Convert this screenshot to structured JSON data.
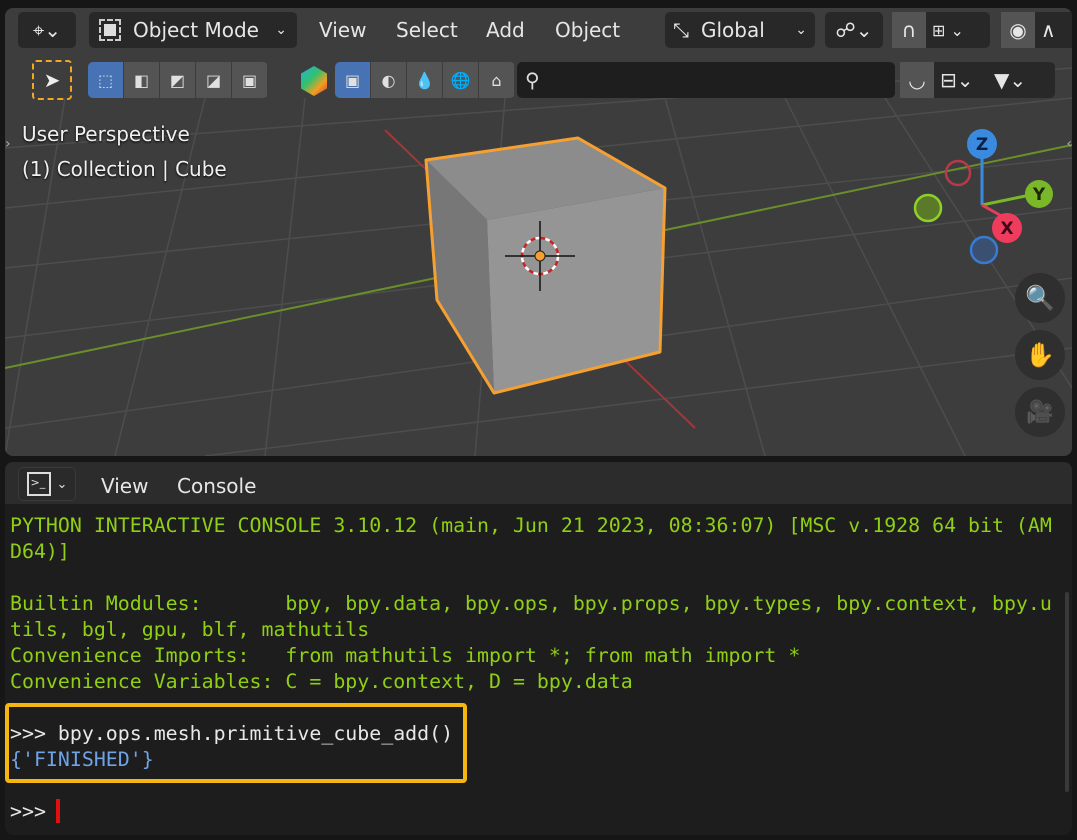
{
  "header": {
    "mode": "Object Mode",
    "menus": [
      "View",
      "Select",
      "Add",
      "Object"
    ],
    "orientation": "Global",
    "search_placeholder": ""
  },
  "viewport": {
    "perspective": "User Perspective",
    "collection": "(1) Collection | Cube",
    "gizmo": {
      "z": "Z",
      "y": "Y",
      "x": "X"
    }
  },
  "console_header": {
    "menus": [
      "View",
      "Console"
    ]
  },
  "console": {
    "lines": [
      {
        "text": "PYTHON INTERACTIVE CONSOLE 3.10.12 (main, Jun 21 2023, 08:36:07) [MSC v.1928 64 bit (AM",
        "cls": "g"
      },
      {
        "text": "D64)]",
        "cls": "g"
      },
      {
        "text": "Builtin Modules:       bpy, bpy.data, bpy.ops, bpy.props, bpy.types, bpy.context, bpy.u",
        "cls": "g"
      },
      {
        "text": "tils, bgl, gpu, blf, mathutils",
        "cls": "g"
      },
      {
        "text": "Convenience Imports:   from mathutils import *; from math import *",
        "cls": "g"
      },
      {
        "text": "Convenience Variables: C = bpy.context, D = bpy.data",
        "cls": "g"
      }
    ],
    "command": ">>> bpy.ops.mesh.primitive_cube_add()",
    "result": "{'FINISHED'}",
    "prompt": ">>> "
  },
  "colors": {
    "highlight": "#f5b60f",
    "console_green": "#8fd014",
    "result_blue": "#6fa3e6",
    "selected_outline": "#f5a030"
  }
}
